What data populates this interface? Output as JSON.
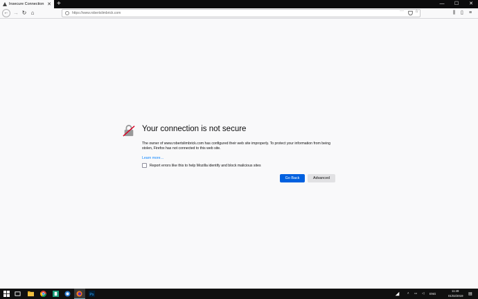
{
  "browser": {
    "tab_title": "Insecure Connection",
    "tab_close": "✕",
    "new_tab": "+",
    "url": "https://www.robertslimbrick.com",
    "window_minimize": "—",
    "window_maximize": "☐",
    "window_close": "✕"
  },
  "error": {
    "title": "Your connection is not secure",
    "description": "The owner of www.robertslimbrick.com has configured their web site improperly. To protect your information from being stolen, Firefox has not connected to this web site.",
    "learn_more": "Learn more…",
    "report_label": "Report errors like this to help Mozilla identify and block malicious sites",
    "go_back": "Go Back",
    "advanced": "Advanced"
  },
  "taskbar": {
    "language": "ENG",
    "time": "11:49",
    "date": "01/02/2019"
  },
  "colors": {
    "primary_button": "#0060df",
    "link": "#0a84ff",
    "tab_bar": "#0c0c0d",
    "taskbar": "#101010"
  }
}
